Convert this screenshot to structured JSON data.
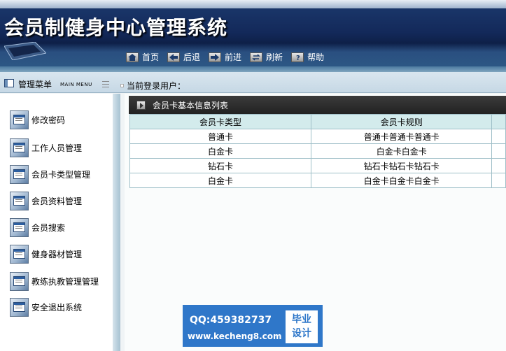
{
  "app": {
    "title": "会员制健身中心管理系统"
  },
  "nav": [
    {
      "label": "首页",
      "icon": "home-icon"
    },
    {
      "label": "后退",
      "icon": "back-arrow-icon"
    },
    {
      "label": "前进",
      "icon": "forward-arrow-icon"
    },
    {
      "label": "刷新",
      "icon": "refresh-icon"
    },
    {
      "label": "帮助",
      "icon": "help-icon"
    }
  ],
  "menu_header": {
    "label": "管理菜单",
    "sub": "MAIN MENU"
  },
  "current_user": {
    "label": "当前登录用户："
  },
  "sidebar": {
    "items": [
      {
        "label": "修改密码"
      },
      {
        "label": "工作人员管理"
      },
      {
        "label": "会员卡类型管理"
      },
      {
        "label": "会员资料管理"
      },
      {
        "label": "会员搜索"
      },
      {
        "label": "健身器材管理"
      },
      {
        "label": "教练执教管理管理"
      },
      {
        "label": "安全退出系统"
      }
    ]
  },
  "list": {
    "title": "会员卡基本信息列表",
    "columns": [
      "会员卡类型",
      "会员卡规则"
    ],
    "rows": [
      [
        "普通卡",
        "普通卡普通卡普通卡"
      ],
      [
        "白金卡",
        "白金卡白金卡"
      ],
      [
        "钻石卡",
        "钻石卡钻石卡钻石卡"
      ],
      [
        "白金卡",
        "白金卡白金卡白金卡"
      ]
    ]
  },
  "watermark": {
    "qq": "QQ:459382737",
    "site": "www.kecheng8.com",
    "badge_line1": "毕业",
    "badge_line2": "设计"
  },
  "colors": {
    "header": "#13295a",
    "accent": "#2f77c9",
    "table_header": "#d3ebec"
  }
}
